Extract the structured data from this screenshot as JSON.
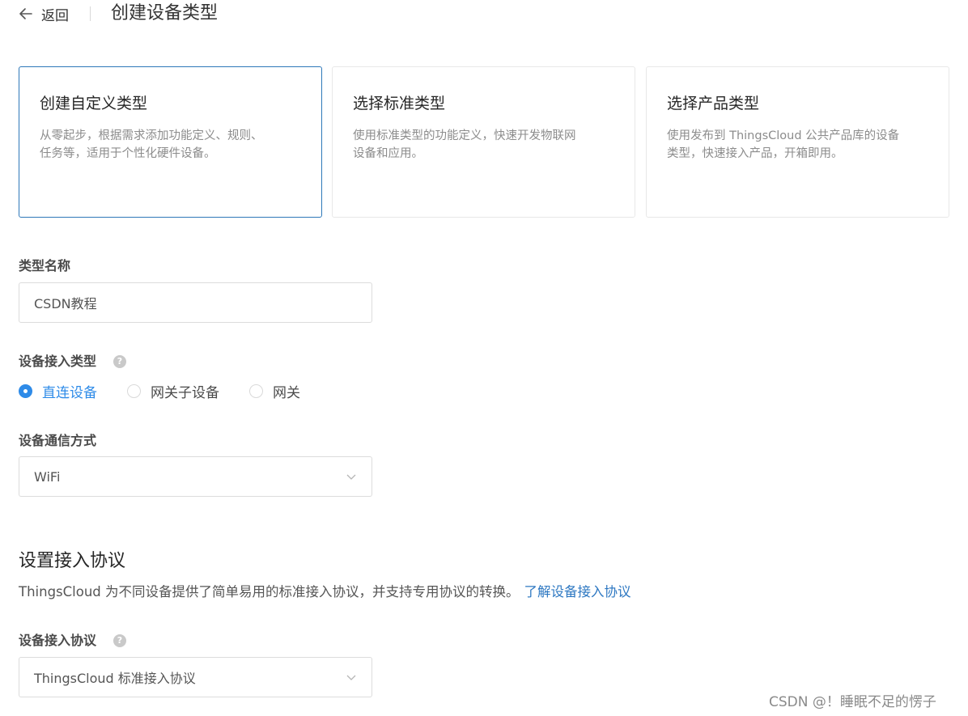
{
  "header": {
    "back_label": "返回",
    "title": "创建设备类型"
  },
  "cards": [
    {
      "title": "创建自定义类型",
      "desc_line1": "从零起步，根据需求添加功能定义、规则、",
      "desc_line2": "任务等，适用于个性化硬件设备。",
      "selected": true
    },
    {
      "title": "选择标准类型",
      "desc_line1": "使用标准类型的功能定义，快速开发物联网",
      "desc_line2": "设备和应用。",
      "selected": false
    },
    {
      "title": "选择产品类型",
      "desc_line1": "使用发布到 ThingsCloud 公共产品库的设备",
      "desc_line2": "类型，快速接入产品，开箱即用。",
      "selected": false
    }
  ],
  "form": {
    "type_name": {
      "label": "类型名称",
      "value": "CSDN教程"
    },
    "access_type": {
      "label": "设备接入类型",
      "help": "?",
      "options": [
        "直连设备",
        "网关子设备",
        "网关"
      ],
      "selected": "直连设备"
    },
    "comm_method": {
      "label": "设备通信方式",
      "value": "WiFi"
    }
  },
  "protocol_section": {
    "title": "设置接入协议",
    "desc": "ThingsCloud 为不同设备提供了简单易用的标准接入协议，并支持专用协议的转换。",
    "link": "了解设备接入协议",
    "protocol": {
      "label": "设备接入协议",
      "help": "?",
      "value": "ThingsCloud 标准接入协议"
    }
  },
  "watermark": "CSDN @！睡眠不足的愣子",
  "colors": {
    "accent": "#2e8be8",
    "selected_border": "#2e78b9",
    "link": "#2e78c2"
  }
}
